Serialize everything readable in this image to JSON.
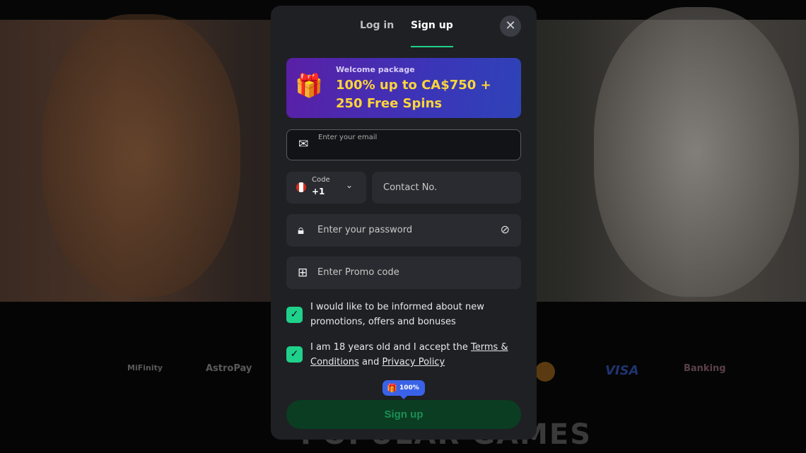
{
  "tabs": [
    {
      "label": "Log in"
    },
    {
      "label": "Sign up",
      "active": true
    }
  ],
  "banner": {
    "subtitle": "Welcome package",
    "title": "100% up to CA$750 + 250 Free Spins"
  },
  "form": {
    "email_placeholder": "Enter your email",
    "code_label": "Code",
    "code_value": "+1",
    "country_flag": "Canada",
    "phone_placeholder": "Contact No.",
    "password_placeholder": "Enter your password",
    "promo_placeholder": "Enter Promo code",
    "consent_promotions": {
      "text": "I would like to be informed about new promotions, offers and bonuses",
      "checked": true
    },
    "consent_age": {
      "text_before": "I am 18 years old and I accept the ",
      "terms": "Terms & Conditions",
      "middle": " and ",
      "privacy": "Privacy Policy",
      "checked": true
    },
    "bonus_badge": "100%",
    "submit_label": "Sign up"
  },
  "background": {
    "payments": [
      "MiFinity",
      "AstroPay",
      "VISA",
      "Banking"
    ],
    "section_title": "POPULAR GAMES"
  },
  "colors": {
    "accent": "#1fd18a",
    "banner_text": "#ffd53a",
    "badge": "#3a62e8"
  }
}
